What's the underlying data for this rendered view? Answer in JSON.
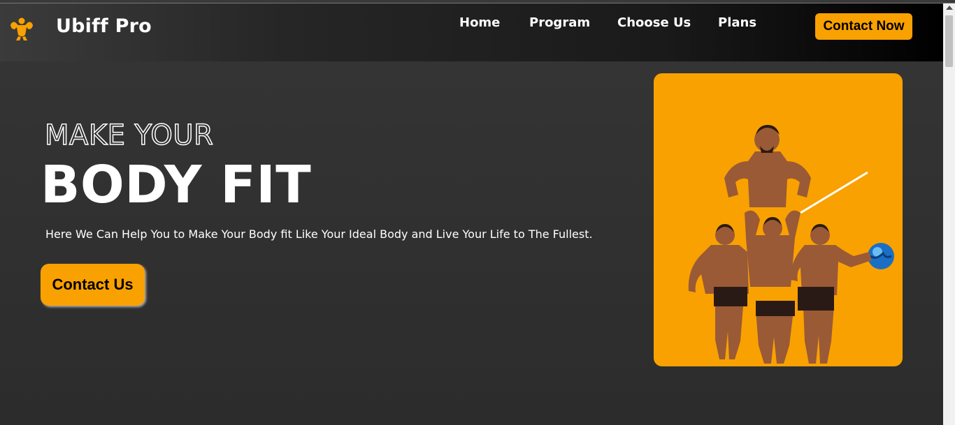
{
  "header": {
    "brand": "Ubiff Pro",
    "logo_icon": "flexing-muscle-man-icon",
    "nav": [
      "Home",
      "Program",
      "Choose Us",
      "Plans"
    ],
    "cta_label": "Contact Now"
  },
  "hero": {
    "headline_line1": "MAKE YOUR",
    "headline_line2": "BODY FIT",
    "subtitle": "Here We Can Help You to Make Your Body fit Like Your Ideal Body and Live Your Life to The Fullest.",
    "cta_label": "Contact Us",
    "image_subject": "bodybuilders-group-photo"
  },
  "colors": {
    "accent": "#f9a100",
    "background": "#2f2f2f",
    "text": "#ffffff"
  }
}
